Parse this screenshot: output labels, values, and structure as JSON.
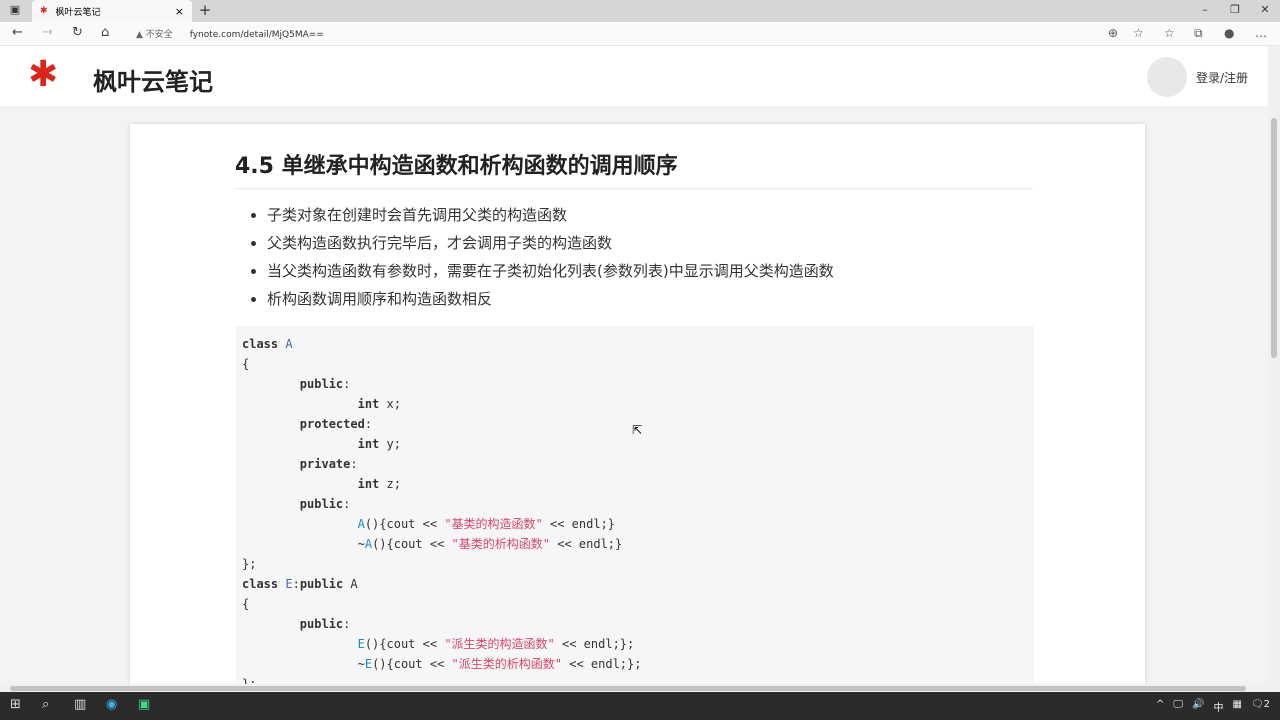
{
  "browser": {
    "tab_title": "枫叶云笔记",
    "tab_close": "×",
    "new_tab": "+",
    "security_label": "不安全",
    "url": "fynote.com/detail/MjQ5MA==",
    "window_controls": [
      "–",
      "❐",
      "✕"
    ]
  },
  "site": {
    "brand": "枫叶云笔记",
    "login": "登录/注册"
  },
  "article": {
    "title": "4.5 单继承中构造函数和析构函数的调用顺序",
    "bullets": [
      "子类对象在创建时会首先调用父类的构造函数",
      "父类构造函数执行完毕后，才会调用子类的构造函数",
      "当父类构造函数有参数时，需要在子类初始化列表(参数列表)中显示调用父类构造函数",
      "析构函数调用顺序和构造函数相反"
    ],
    "code": [
      [
        [
          "kw",
          "class "
        ],
        [
          "nm",
          "A"
        ]
      ],
      [
        [
          "p",
          "{"
        ]
      ],
      [
        [
          "p",
          "        "
        ],
        [
          "kw",
          "public"
        ],
        [
          "p",
          ":"
        ]
      ],
      [
        [
          "p",
          "                "
        ],
        [
          "kw",
          "int"
        ],
        [
          "p",
          " x;"
        ]
      ],
      [
        [
          "p",
          "        "
        ],
        [
          "kw",
          "protected"
        ],
        [
          "p",
          ":"
        ]
      ],
      [
        [
          "p",
          "                "
        ],
        [
          "kw",
          "int"
        ],
        [
          "p",
          " y;"
        ]
      ],
      [
        [
          "p",
          "        "
        ],
        [
          "kw",
          "private"
        ],
        [
          "p",
          ":"
        ]
      ],
      [
        [
          "p",
          "                "
        ],
        [
          "kw",
          "int"
        ],
        [
          "p",
          " z;"
        ]
      ],
      [
        [
          "p",
          "        "
        ],
        [
          "kw",
          "public"
        ],
        [
          "p",
          ":"
        ]
      ],
      [
        [
          "p",
          "                "
        ],
        [
          "fn",
          "A"
        ],
        [
          "p",
          "(){cout << "
        ],
        [
          "str",
          "\"基类的构造函数\""
        ],
        [
          "p",
          " << endl;}"
        ]
      ],
      [
        [
          "p",
          "                ~"
        ],
        [
          "fn",
          "A"
        ],
        [
          "p",
          "(){cout << "
        ],
        [
          "str",
          "\"基类的析构函数\""
        ],
        [
          "p",
          " << endl;}"
        ]
      ],
      [
        [
          "p",
          "};"
        ]
      ],
      [
        [
          "kw",
          "class "
        ],
        [
          "nm",
          "E"
        ],
        [
          "p",
          ":"
        ],
        [
          "kw",
          "public"
        ],
        [
          "p",
          " A"
        ]
      ],
      [
        [
          "p",
          "{"
        ]
      ],
      [
        [
          "p",
          "        "
        ],
        [
          "kw",
          "public"
        ],
        [
          "p",
          ":"
        ]
      ],
      [
        [
          "p",
          "                "
        ],
        [
          "fn",
          "E"
        ],
        [
          "p",
          "(){cout << "
        ],
        [
          "str",
          "\"派生类的构造函数\""
        ],
        [
          "p",
          " << endl;};"
        ]
      ],
      [
        [
          "p",
          "                ~"
        ],
        [
          "fn",
          "E"
        ],
        [
          "p",
          "(){cout << "
        ],
        [
          "str",
          "\"派生类的析构函数\""
        ],
        [
          "p",
          " << endl;};"
        ]
      ],
      [
        [
          "p",
          "};"
        ]
      ]
    ]
  },
  "taskbar": {
    "tray": [
      "^",
      "🖵",
      "🔊",
      "中",
      "▦",
      "🗨2"
    ]
  },
  "colors": {
    "brand_red": "#d9261c",
    "string": "#d9466a",
    "function": "#1a8fbf"
  }
}
